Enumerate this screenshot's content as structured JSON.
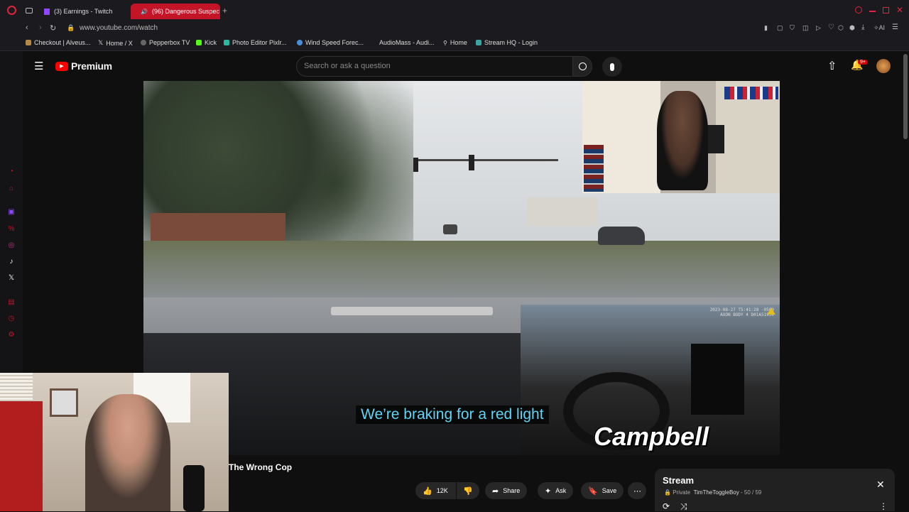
{
  "browser": {
    "tabs": [
      {
        "label": "(3) Earnings - Twitch",
        "active": false
      },
      {
        "label": "(96) Dangerous Suspec",
        "active": true
      }
    ],
    "url": "www.youtube.com/watch",
    "bookmarks": [
      "Checkout | Alveus...",
      "Home / X",
      "Pepperbox TV",
      "Kick",
      "Photo Editor Pixlr...",
      "Wind Speed Forec...",
      "AudioMass - Audi...",
      "Home",
      "Stream HQ - Login"
    ],
    "ai_label": "AI"
  },
  "youtube": {
    "logo_text": "Premium",
    "search_placeholder": "Search or ask a question",
    "notification_count": "9+"
  },
  "video": {
    "caption": "We’re braking for a red light",
    "name_overlay": "Campbell",
    "bodycam_stamp": "2023-08-27 T5:41:28 -0500\nAXON BODY 4 D01A5193V",
    "title": "The Wrong Cop"
  },
  "actions": {
    "like_count": "12K",
    "share": "Share",
    "ask": "Ask",
    "save": "Save"
  },
  "playlist": {
    "title": "Stream",
    "privacy": "Private",
    "owner": "TimTheToggleBoy",
    "position": "50 / 59"
  },
  "colors": {
    "accent": "#c41428",
    "youtube_red": "#ff0000",
    "caption": "#5fd4f5"
  }
}
